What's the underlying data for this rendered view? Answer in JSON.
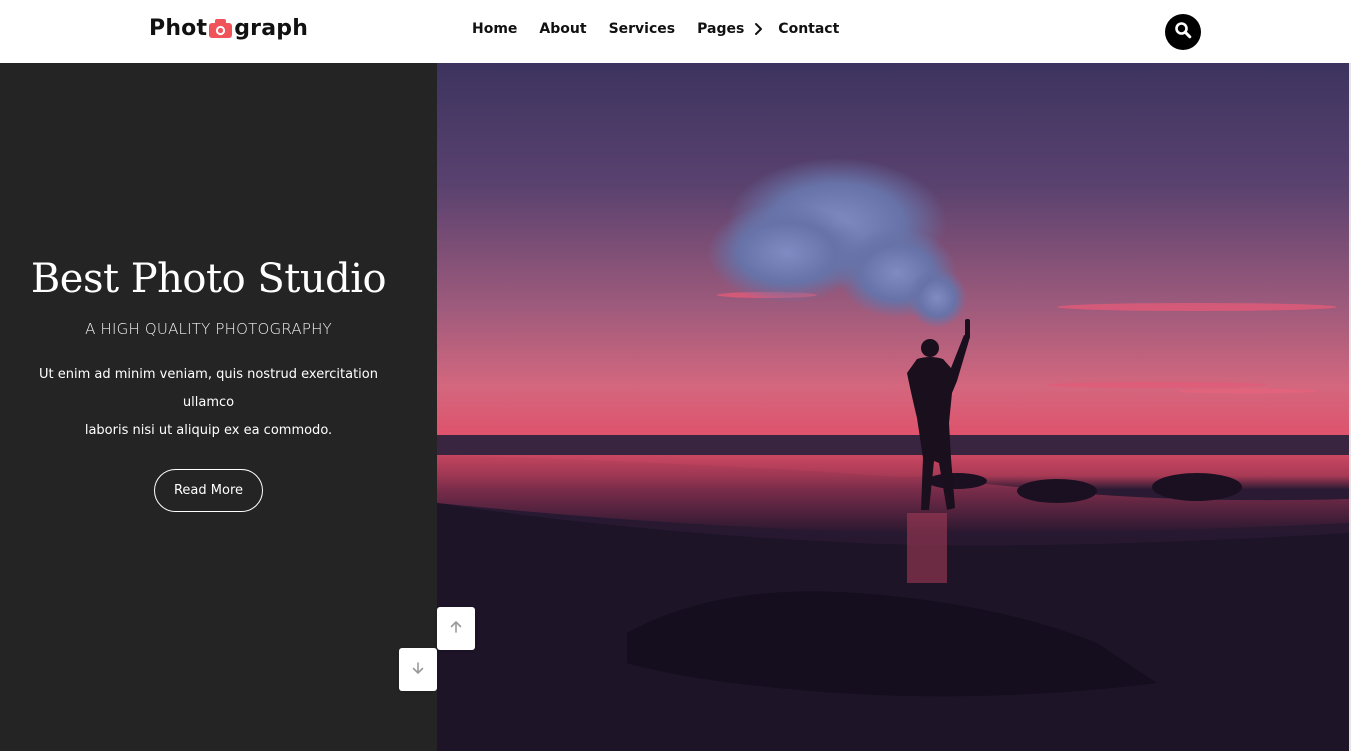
{
  "brand": {
    "logo_left": "Phot",
    "logo_icon": "camera-icon",
    "logo_right": "graph",
    "accent_color": "#f0545a"
  },
  "nav": {
    "items": [
      {
        "label": "Home"
      },
      {
        "label": "About"
      },
      {
        "label": "Services"
      },
      {
        "label": "Pages"
      },
      {
        "label": "Contact"
      }
    ],
    "pages_icon": "chevron-right-icon",
    "search_icon": "search-icon"
  },
  "hero": {
    "title": "Best Photo Studio",
    "subtitle": "A HIGH QUALITY PHOTOGRAPHY",
    "text_line1": "Ut enim ad minim veniam, quis nostrud exercitation ullamco",
    "text_line2": "laboris nisi ut aliquip ex ea commodo.",
    "button_label": "Read More",
    "panel_color": "#242424"
  },
  "slider": {
    "prev_icon": "arrow-up-icon",
    "next_icon": "arrow-down-icon"
  }
}
